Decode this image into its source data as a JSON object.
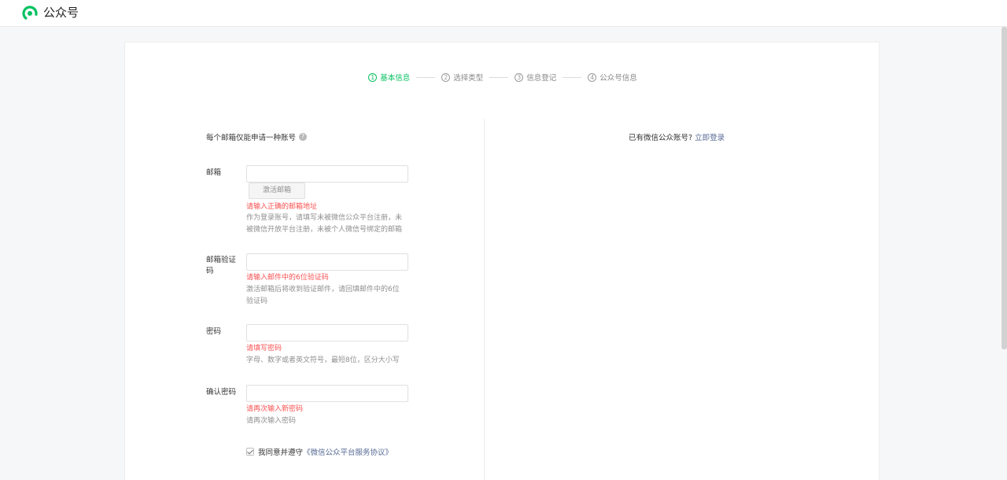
{
  "header": {
    "title": "公众号",
    "logo_icon": "wechat-official-account-logo-icon"
  },
  "steps": [
    {
      "num": "1",
      "label": "基本信息",
      "active": true
    },
    {
      "num": "2",
      "label": "选择类型",
      "active": false
    },
    {
      "num": "3",
      "label": "信息登记",
      "active": false
    },
    {
      "num": "4",
      "label": "公众号信息",
      "active": false
    }
  ],
  "left": {
    "note": "每个邮箱仅能申请一种账号",
    "help_icon": "?"
  },
  "right": {
    "question": "已有微信公众账号?",
    "login_link": "立即登录"
  },
  "form": {
    "email": {
      "label": "邮箱",
      "value": "",
      "activate_button": "激活邮箱",
      "error": "请输入正确的邮箱地址",
      "tip": "作为登录账号，请填写未被微信公众平台注册，未被微信开放平台注册，未被个人微信号绑定的邮箱"
    },
    "verify_code": {
      "label": "邮箱验证码",
      "value": "",
      "error": "请输入邮件中的6位验证码",
      "tip": "激活邮箱后将收到验证邮件，请回填邮件中的6位验证码"
    },
    "password": {
      "label": "密码",
      "value": "",
      "error": "请填写密码",
      "tip": "字母、数字或者英文符号，最短8位，区分大小写"
    },
    "confirm_password": {
      "label": "确认密码",
      "value": "",
      "error": "请再次输入新密码",
      "tip": "请再次输入密码"
    },
    "agreement": {
      "checked": true,
      "prefix": "我同意并遵守",
      "link": "《微信公众平台服务协议》"
    }
  },
  "colors": {
    "accent": "#07c160",
    "error": "#fa5151",
    "link": "#576b95",
    "muted": "#8f8f8f"
  }
}
